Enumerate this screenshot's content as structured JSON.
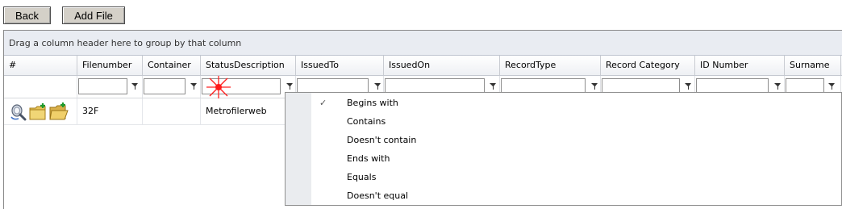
{
  "toolbar": {
    "back_label": "Back",
    "add_file_label": "Add File"
  },
  "grid": {
    "group_hint": "Drag a column header here to group by that column",
    "columns": [
      "#",
      "Filenumber",
      "Container",
      "StatusDescription",
      "IssuedTo",
      "IssuedOn",
      "RecordType",
      "Record Category",
      "ID Number",
      "Surname"
    ],
    "rows": [
      {
        "icons": [
          "search-file-icon",
          "new-folder-icon",
          "open-folder-icon"
        ],
        "filenumber": "32F",
        "container": "",
        "status_description": "Metrofilerweb"
      }
    ]
  },
  "filter_menu": {
    "selected": "Begins with",
    "items": [
      "Begins with",
      "Contains",
      "Doesn't contain",
      "Ends with",
      "Equals",
      "Doesn't equal"
    ]
  },
  "colors": {
    "group_panel_bg": "#e9ecf2",
    "button_bg": "#d4d0c8",
    "menu_gutter": "#eaecef"
  }
}
